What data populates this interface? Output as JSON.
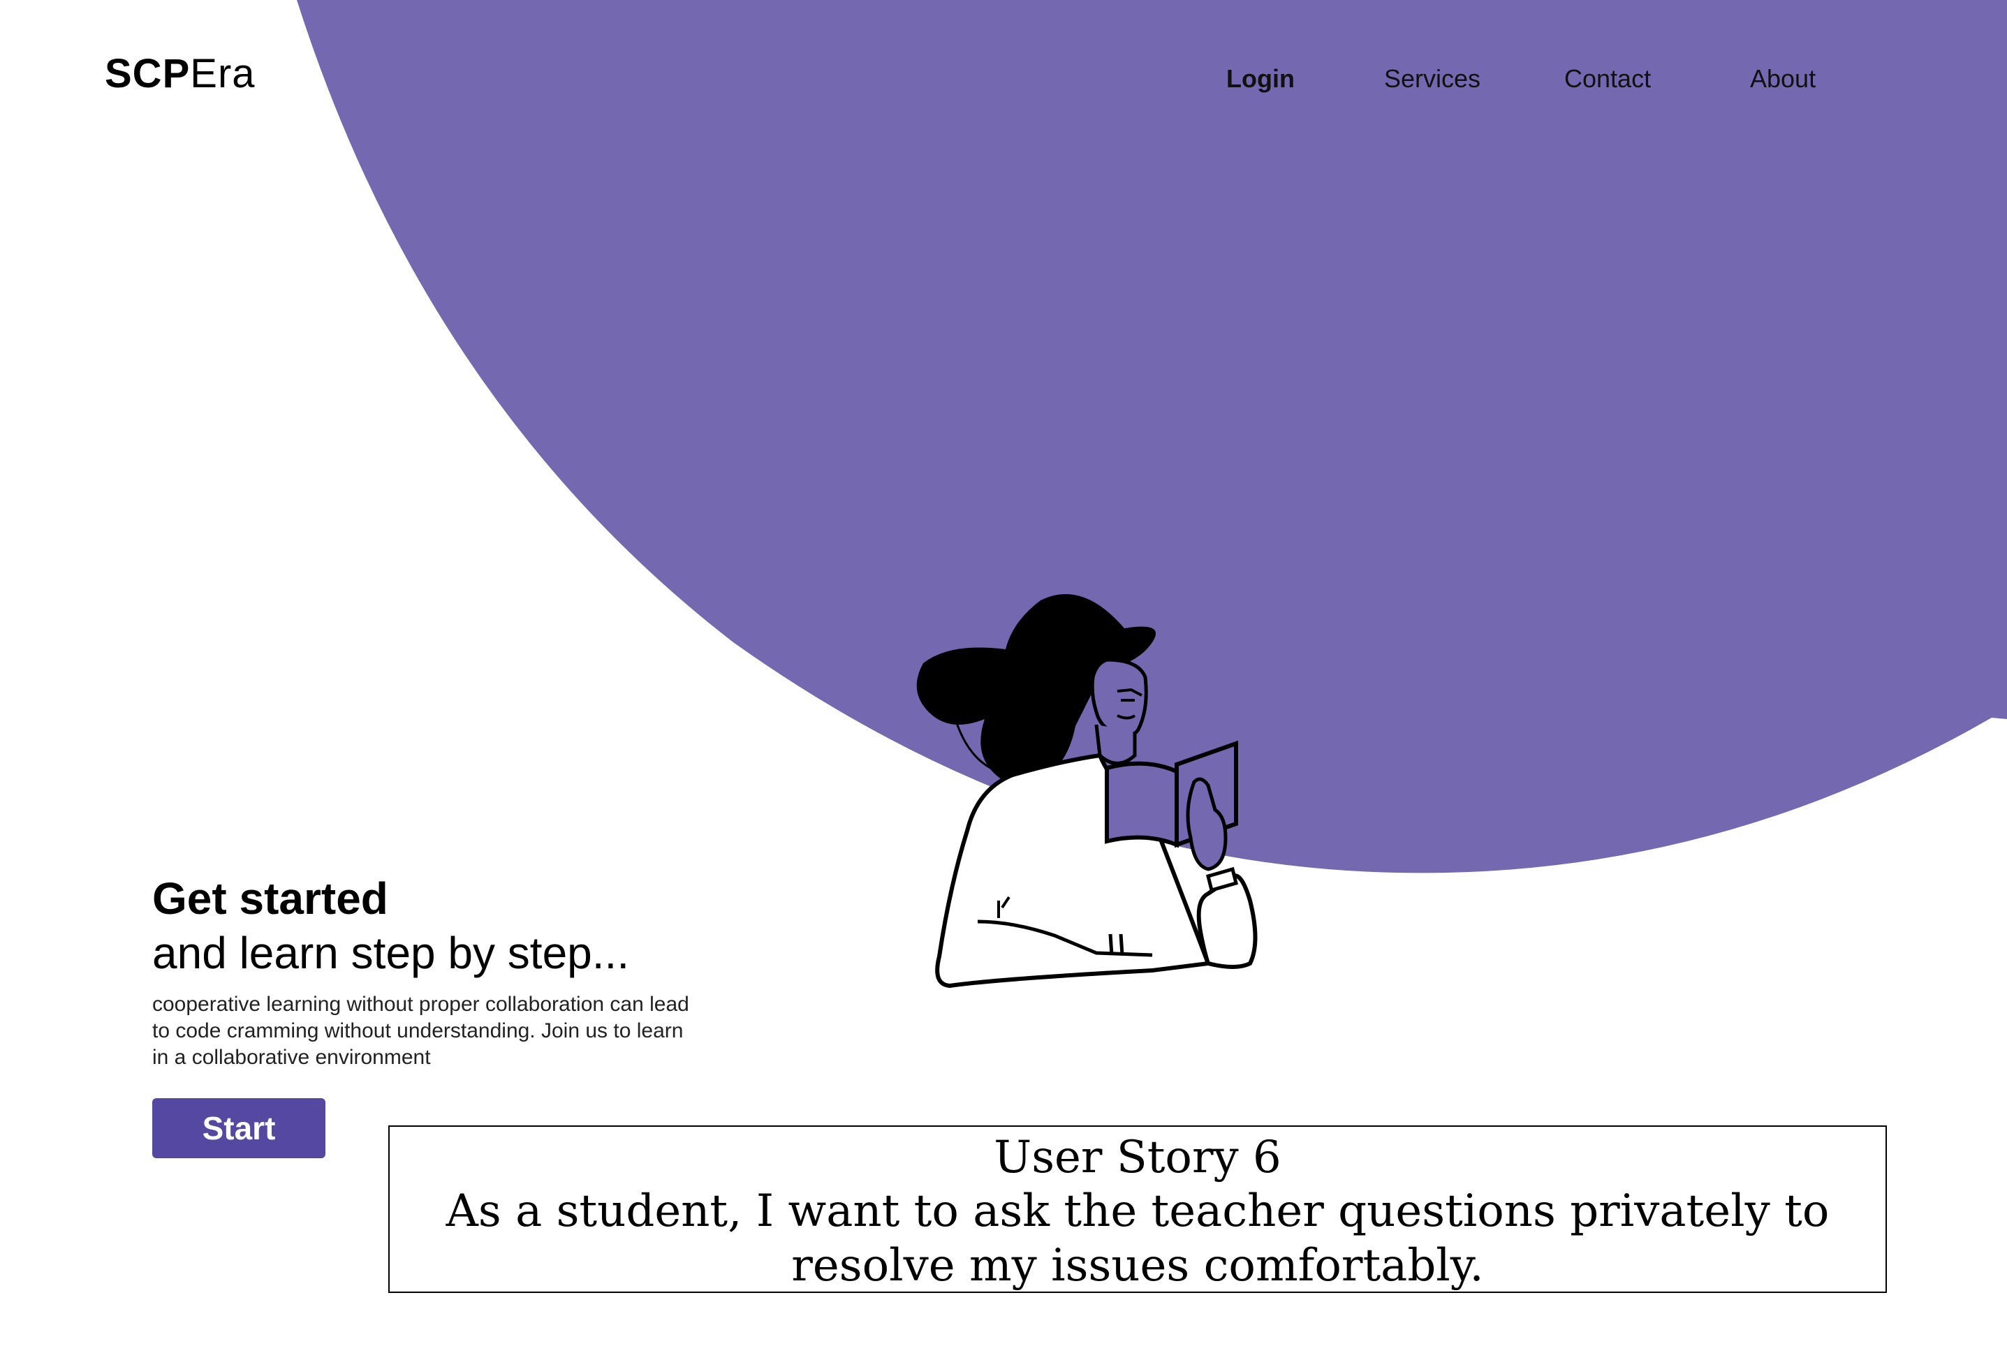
{
  "colors": {
    "accent": "#7468b0",
    "button": "#5548a0",
    "text": "#000000",
    "background": "#ffffff"
  },
  "header": {
    "logo_bold": "SCP",
    "logo_light": "Era",
    "nav": {
      "login": "Login",
      "services": "Services",
      "contact": "Contact",
      "about": "About"
    }
  },
  "hero": {
    "title": "Get started",
    "subtitle": "and learn step by step...",
    "description": "cooperative learning without proper collaboration can lead to code cramming without understanding. Join us to learn in a collaborative environment",
    "button_label": "Start",
    "illustration": "woman-reading-book-illustration"
  },
  "story": {
    "title": "User Story 6",
    "text": "As a student, I want to ask the teacher questions privately to resolve my issues comfortably."
  }
}
